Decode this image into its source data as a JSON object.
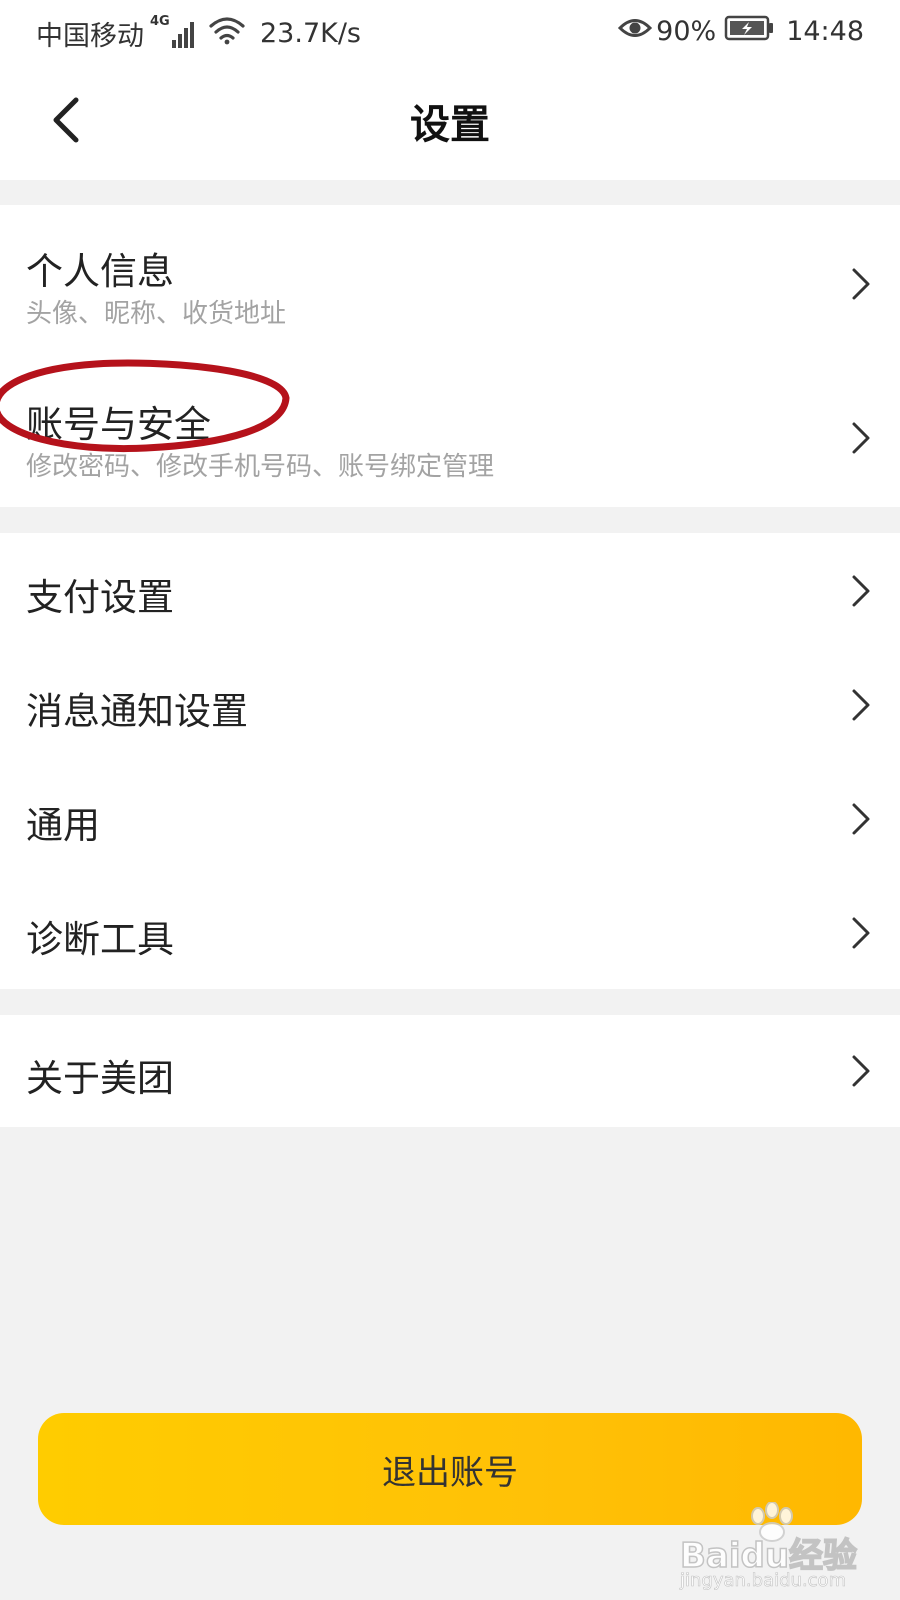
{
  "status_bar": {
    "carrier": "中国移动",
    "network_type": "4G",
    "speed": "23.7K/s",
    "battery": "90%",
    "time": "14:48"
  },
  "header": {
    "title": "设置"
  },
  "groups": [
    {
      "items": [
        {
          "title": "个人信息",
          "subtitle": "头像、昵称、收货地址"
        },
        {
          "title": "账号与安全",
          "subtitle": "修改密码、修改手机号码、账号绑定管理"
        }
      ]
    },
    {
      "items": [
        {
          "title": "支付设置"
        },
        {
          "title": "消息通知设置"
        },
        {
          "title": "通用"
        },
        {
          "title": "诊断工具"
        }
      ]
    },
    {
      "items": [
        {
          "title": "关于美团"
        }
      ]
    }
  ],
  "logout": {
    "label": "退出账号"
  },
  "watermark": {
    "brand": "Baidu经验",
    "url": "jingyan.baidu.com"
  },
  "colors": {
    "accent": "#FFC300",
    "annotation": "#B5121B",
    "subtitle": "#A3A3A3"
  }
}
